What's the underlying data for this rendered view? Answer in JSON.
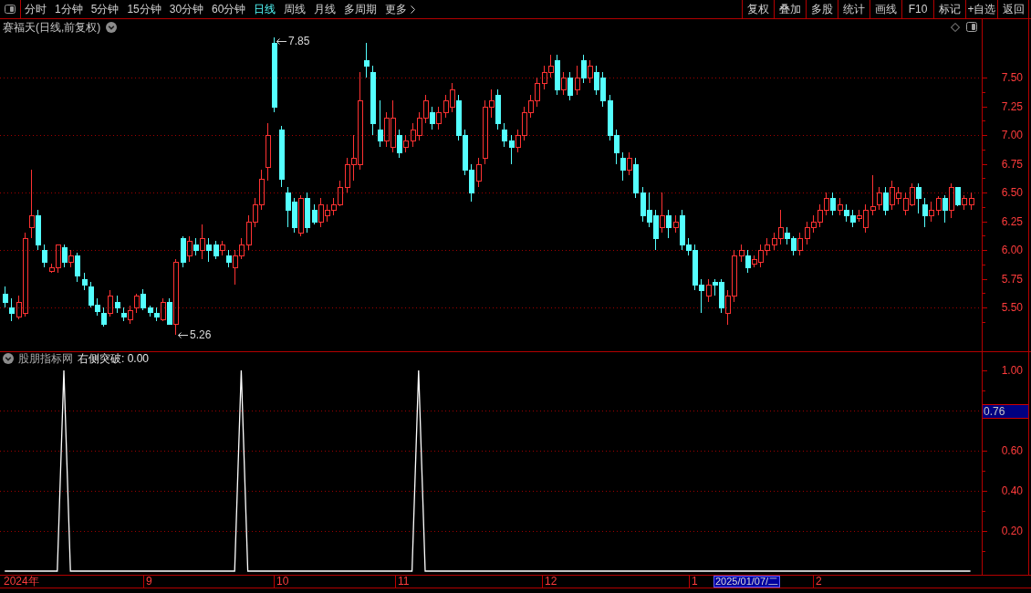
{
  "toolbar": {
    "tabs": [
      {
        "label": "分时",
        "selected": false
      },
      {
        "label": "1分钟",
        "selected": false
      },
      {
        "label": "5分钟",
        "selected": false
      },
      {
        "label": "15分钟",
        "selected": false
      },
      {
        "label": "30分钟",
        "selected": false
      },
      {
        "label": "60分钟",
        "selected": false
      },
      {
        "label": "日线",
        "selected": true
      },
      {
        "label": "周线",
        "selected": false
      },
      {
        "label": "月线",
        "selected": false
      },
      {
        "label": "多周期",
        "selected": false
      }
    ],
    "more_menu": "更多",
    "buttons": [
      "复权",
      "叠加",
      "多股",
      "统计",
      "画线",
      "F10",
      "标记",
      "+自选",
      "返回"
    ]
  },
  "price_chart": {
    "title": "赛福天(日线,前复权)",
    "high_label": "7.85",
    "low_label": "5.26",
    "price_axis": [
      "7.50",
      "7.25",
      "7.00",
      "6.75",
      "6.50",
      "6.25",
      "6.00",
      "5.75",
      "5.50"
    ]
  },
  "indicator": {
    "source": "股朋指标网",
    "readout": "右侧突破: 0.00",
    "cursor_value": "0.76",
    "chart_data": {
      "type": "line",
      "grid": true,
      "series": [
        {
          "color": "#ffffff",
          "values": [
            0,
            0,
            0,
            0,
            0,
            0,
            0,
            0,
            0,
            1,
            0,
            0,
            0,
            0,
            0,
            0,
            0,
            0,
            0,
            0,
            0,
            0,
            0,
            0,
            0,
            0,
            0,
            0,
            0,
            0,
            0,
            0,
            0,
            0,
            0,
            0,
            1,
            0,
            0,
            0,
            0,
            0,
            0,
            0,
            0,
            0,
            0,
            0,
            0,
            0,
            0,
            0,
            0,
            0,
            0,
            0,
            0,
            0,
            0,
            0,
            0,
            0,
            0,
            1,
            0,
            0,
            0,
            0,
            0,
            0,
            0,
            0,
            0,
            0,
            0,
            0,
            0,
            0,
            0,
            0,
            0,
            0,
            0,
            0,
            0,
            0,
            0,
            0,
            0,
            0,
            0,
            0,
            0,
            0,
            0,
            0,
            0,
            0,
            0,
            0,
            0,
            0,
            0,
            0,
            0,
            0,
            0,
            0,
            0,
            0,
            0,
            0,
            0,
            0,
            0,
            0,
            0,
            0,
            0,
            0,
            0,
            0,
            0,
            0,
            0,
            0,
            0,
            0,
            0,
            0,
            0,
            0,
            0,
            0,
            0,
            0,
            0,
            0,
            0,
            0,
            0,
            0,
            0,
            0,
            0,
            0,
            0,
            0
          ]
        }
      ],
      "ylim": [
        0,
        1
      ],
      "yticks": [
        {
          "value": 1,
          "label": "1.00"
        },
        {
          "value": 0.6,
          "label": "0.60"
        },
        {
          "value": 0.4,
          "label": "0.40"
        },
        {
          "value": 0.2,
          "label": "0.20"
        }
      ]
    }
  },
  "time_axis": {
    "labels": [
      {
        "kind": "tick",
        "text": "2024年"
      },
      {
        "kind": "tick",
        "text": "9"
      },
      {
        "kind": "tick",
        "text": "10"
      },
      {
        "kind": "tick",
        "text": "11"
      },
      {
        "kind": "tick",
        "text": "12"
      },
      {
        "kind": "tick",
        "text": "1"
      },
      {
        "kind": "cursor",
        "text": "2025/01/07/二"
      },
      {
        "kind": "tick",
        "text": "2"
      }
    ]
  }
}
